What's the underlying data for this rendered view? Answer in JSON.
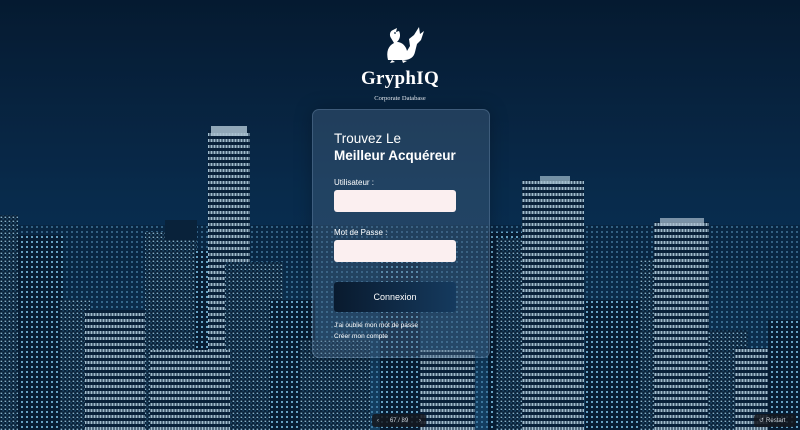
{
  "brand": {
    "name": "GryphIQ",
    "tagline": "Corporate Database"
  },
  "login": {
    "title_line1": "Trouvez Le",
    "title_line2": "Meilleur Acquéreur",
    "username_label": "Utilisateur :",
    "password_label": "Mot de Passe :",
    "submit_label": "Connexion",
    "forgot_label": "J'ai oublié mon mot de passe",
    "signup_label": "Créer mon compte"
  },
  "player": {
    "prev_icon": "chevron-left",
    "page_label": "67 / 89",
    "next_icon": "chevron-right",
    "restart_label": "Restart"
  },
  "colors": {
    "background": "#04172b",
    "input_bg": "#fbeff0",
    "button": "#0c2440",
    "accent_lights": "#7fc8f0"
  }
}
